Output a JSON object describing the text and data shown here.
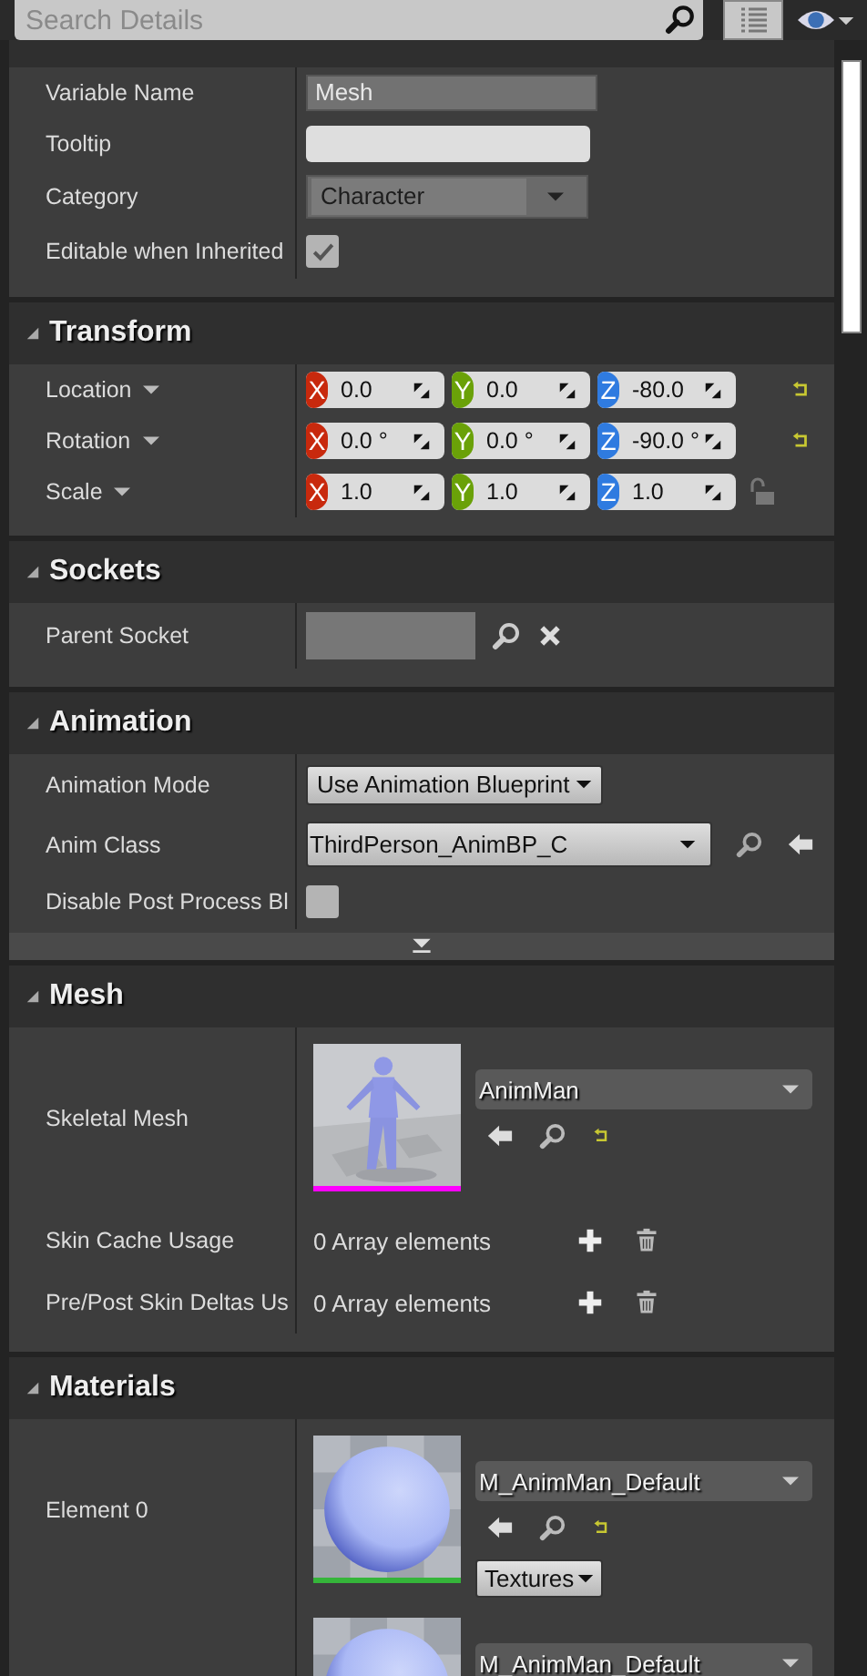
{
  "search": {
    "placeholder": "Search Details"
  },
  "sections": [
    {
      "rows": [
        {
          "kind": "text",
          "label": "Variable Name",
          "value": "Mesh"
        },
        {
          "kind": "input",
          "label": "Tooltip"
        },
        {
          "kind": "combo",
          "label": "Category",
          "value": "Character"
        },
        {
          "kind": "checkbox",
          "label": "Editable when Inherited",
          "checked": true
        }
      ]
    },
    {
      "title": "Transform",
      "rows": [
        {
          "kind": "vector",
          "label": "Location",
          "components": [
            {
              "axis": "X",
              "value": "0.0"
            },
            {
              "axis": "Y",
              "value": "0.0"
            },
            {
              "axis": "Z",
              "value": "-80.0"
            }
          ],
          "reset": true
        },
        {
          "kind": "vector",
          "label": "Rotation",
          "components": [
            {
              "axis": "X",
              "value": "0.0 °"
            },
            {
              "axis": "Y",
              "value": "0.0 °"
            },
            {
              "axis": "Z",
              "value": "-90.0 °"
            }
          ],
          "reset": true
        },
        {
          "kind": "vector",
          "label": "Scale",
          "components": [
            {
              "axis": "X",
              "value": "1.0"
            },
            {
              "axis": "Y",
              "value": "1.0"
            },
            {
              "axis": "Z",
              "value": "1.0"
            }
          ],
          "reset": false,
          "locked": false
        }
      ]
    },
    {
      "title": "Sockets",
      "rows": [
        {
          "kind": "socket",
          "label": "Parent Socket"
        }
      ]
    },
    {
      "title": "Animation",
      "advanced": true,
      "rows": [
        {
          "kind": "enum",
          "label": "Animation Mode",
          "value": "Use Animation Blueprint"
        },
        {
          "kind": "class",
          "label": "Anim Class",
          "value": "ThirdPerson_AnimBP_C"
        },
        {
          "kind": "checkbox",
          "label": "Disable Post Process Bl",
          "checked": false
        }
      ]
    },
    {
      "title": "Mesh",
      "rows": [
        {
          "kind": "mesh",
          "label": "Skeletal Mesh",
          "value": "AnimMan",
          "color": "#ff00ff",
          "actions": true
        },
        {
          "kind": "array",
          "label": "Skin Cache Usage",
          "value": "0 Array elements"
        },
        {
          "kind": "array",
          "label": "Pre/Post Skin Deltas Us",
          "value": "0 Array elements"
        }
      ]
    },
    {
      "title": "Materials",
      "rows": [
        {
          "kind": "material",
          "label": "Element 0",
          "value": "M_AnimMan_Default",
          "color": "#35b53a",
          "actions": true,
          "button": "Textures"
        },
        {
          "kind": "material",
          "value": "M_AnimMan_Default"
        }
      ]
    }
  ]
}
